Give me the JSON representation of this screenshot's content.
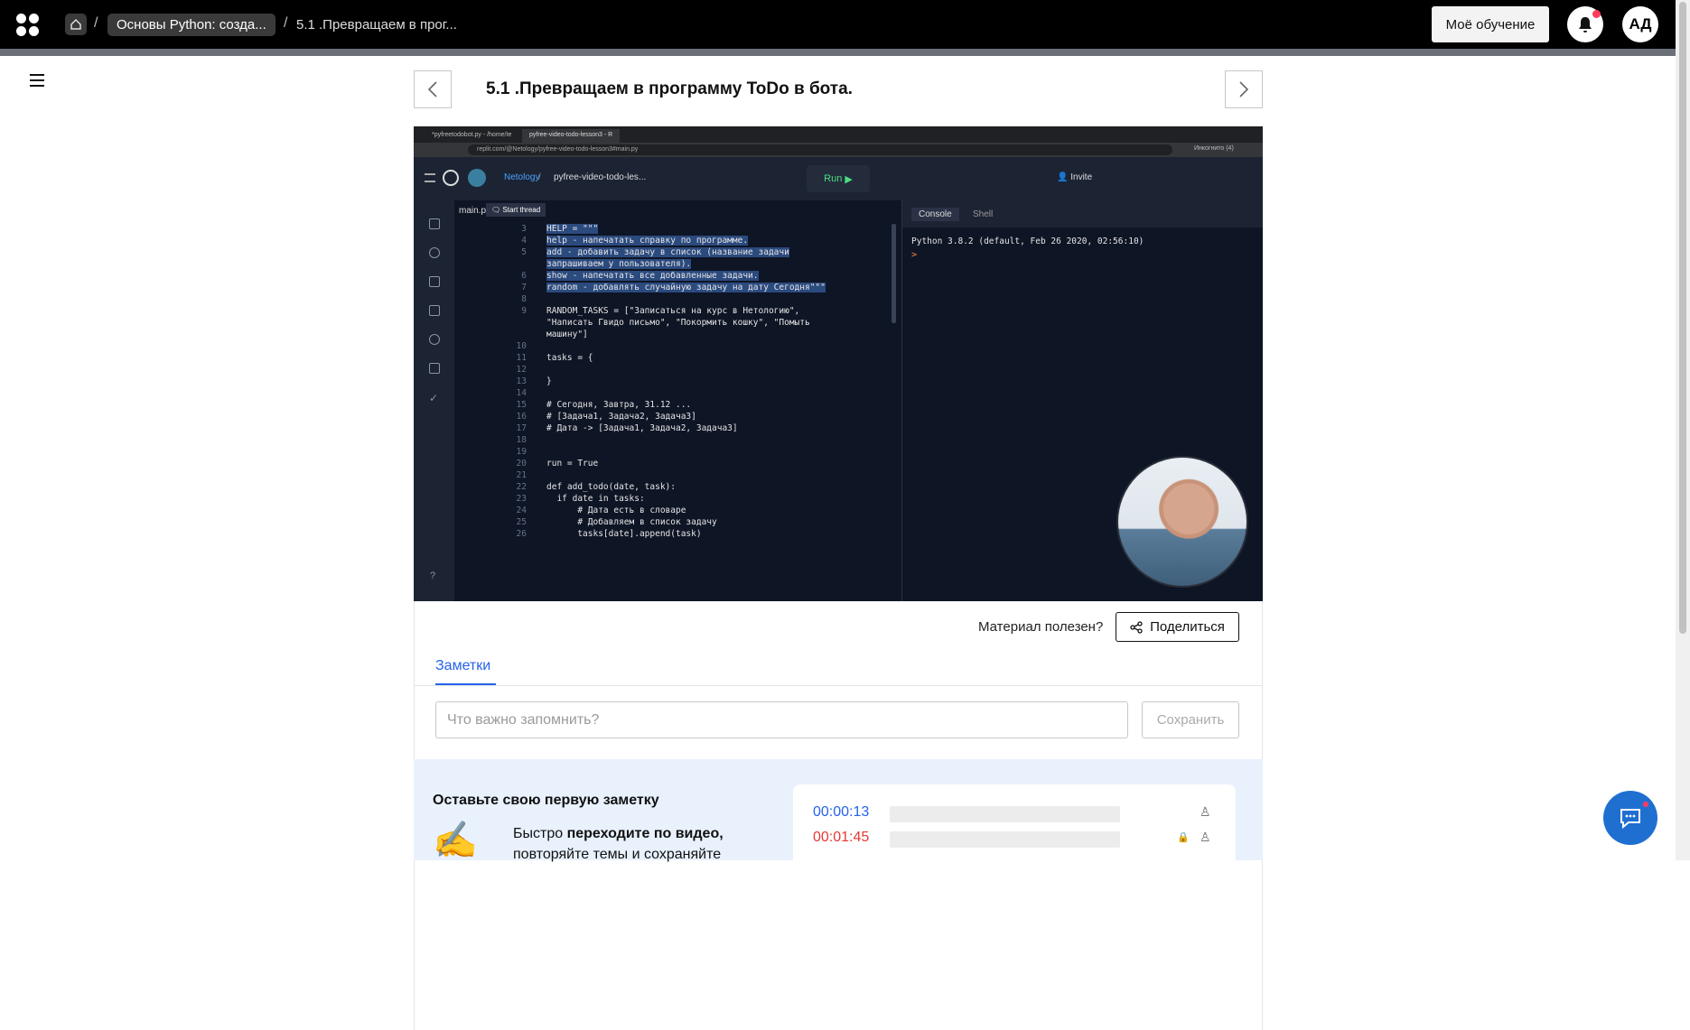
{
  "header": {
    "breadcrumb_course": "Основы Python: созда...",
    "breadcrumb_lesson": "5.1 .Превращаем в прог...",
    "my_learning": "Моё обучение",
    "avatar_initials": "АД",
    "brand_color": "#000000",
    "notification_dot_color": "#ff3b5c"
  },
  "lesson": {
    "title": "5.1 .Превращаем в программу ToDo в бота."
  },
  "video": {
    "browser_tab_1": "*pyfreetodobot.py - /home/te",
    "browser_tab_2": "pyfree-video-todo-lesson3 - R",
    "url": "replit.com/@Netology/pyfree-video-todo-lesson3#main.py",
    "incognito": "Инкогнито (4)",
    "replit_owner": "Netology",
    "replit_repl": "pyfree-video-todo-les...",
    "run_label": "Run",
    "invite_label": "Invite",
    "file_tab": "main.p",
    "start_thread": "Start thread",
    "console_tab": "Console",
    "shell_tab": "Shell",
    "console_line": "Python 3.8.2 (default, Feb 26 2020, 02:56:10)",
    "console_prompt": ">",
    "help_icon": "?",
    "code_lines": [
      {
        "n": "3",
        "t": "HELP = \"\"\"",
        "sel": true
      },
      {
        "n": "4",
        "t": "help - напечатать справку по программе.",
        "sel": true
      },
      {
        "n": "5",
        "t": "add - добавить задачу в список (название задачи",
        "sel": true
      },
      {
        "n": "",
        "t": "запрашиваем у пользователя).",
        "sel": true
      },
      {
        "n": "6",
        "t": "show - напечатать все добавленные задачи.",
        "sel": true
      },
      {
        "n": "7",
        "t": "random - добавлять случайную задачу на дату Сегодня\"\"\"",
        "sel": true
      },
      {
        "n": "8",
        "t": "",
        "sel": false
      },
      {
        "n": "9",
        "t": "RANDOM_TASKS = [\"Записаться на курс в Нетологию\",",
        "sel": false
      },
      {
        "n": "",
        "t": "\"Написать Гвидо письмо\", \"Покормить кошку\", \"Помыть",
        "sel": false
      },
      {
        "n": "",
        "t": "машину\"]",
        "sel": false
      },
      {
        "n": "10",
        "t": "",
        "sel": false
      },
      {
        "n": "11",
        "t": "tasks = {",
        "sel": false
      },
      {
        "n": "12",
        "t": "",
        "sel": false
      },
      {
        "n": "13",
        "t": "}",
        "sel": false
      },
      {
        "n": "14",
        "t": "",
        "sel": false
      },
      {
        "n": "15",
        "t": "# Сегодня, Завтра, 31.12 ...",
        "sel": false
      },
      {
        "n": "16",
        "t": "# [Задача1, Задача2, Задача3]",
        "sel": false
      },
      {
        "n": "17",
        "t": "# Дата -> [Задача1, Задача2, Задача3]",
        "sel": false
      },
      {
        "n": "18",
        "t": "",
        "sel": false
      },
      {
        "n": "19",
        "t": "",
        "sel": false
      },
      {
        "n": "20",
        "t": "run = True",
        "sel": false
      },
      {
        "n": "21",
        "t": "",
        "sel": false
      },
      {
        "n": "22",
        "t": "def add_todo(date, task):",
        "sel": false
      },
      {
        "n": "23",
        "t": "  if date in tasks:",
        "sel": false
      },
      {
        "n": "24",
        "t": "      # Дата есть в словаре",
        "sel": false
      },
      {
        "n": "25",
        "t": "      # Добавляем в список задачу",
        "sel": false
      },
      {
        "n": "26",
        "t": "      tasks[date].append(task)",
        "sel": false
      }
    ]
  },
  "feedback": {
    "useful_question": "Материал полезен?",
    "share_label": "Поделиться"
  },
  "notes": {
    "tab_label": "Заметки",
    "input_placeholder": "Что важно запомнить?",
    "input_value": "",
    "save_label": "Сохранить",
    "accent_color": "#2563eb"
  },
  "promo": {
    "title": "Оставьте свою первую заметку",
    "text_prefix": "Быстро ",
    "text_bold": "переходите по видео,",
    "text_suffix": "повторяйте темы и сохраняйте",
    "emoji": "✍",
    "timecode_1": "00:00:13",
    "timecode_2": "00:01:45",
    "timecode_1_color": "#2563eb",
    "timecode_2_color": "#e53935"
  },
  "chat": {
    "fab_color": "#1f6fd1"
  }
}
